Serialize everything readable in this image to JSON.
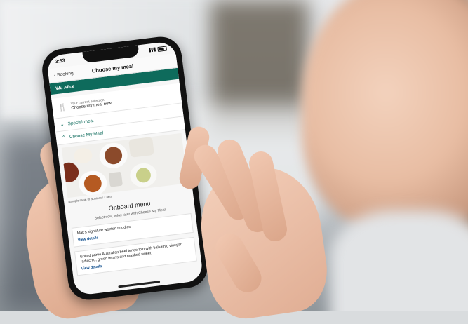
{
  "status_bar": {
    "time": "3:33"
  },
  "nav": {
    "back_label": "Booking",
    "title": "Choose my meal"
  },
  "passenger": {
    "name": "Wu Alice"
  },
  "selection": {
    "label": "Your current selection",
    "value": "Choose my meal now"
  },
  "accordions": [
    {
      "label": "Special meal",
      "expanded": false
    },
    {
      "label": "Choose My Meal",
      "expanded": true
    }
  ],
  "gallery": {
    "caption": "Sample meal in Business Class"
  },
  "menu": {
    "title": "Onboard menu",
    "subtitle": "Select now, relax later with Choose My Meal.",
    "items": [
      {
        "name": "Mak's signature wonton noodles",
        "link": "View details"
      },
      {
        "name": "Grilled prime Australian beef tenderloin with balsamic vinegar radicchio, green beans and mashed sweet",
        "link": "View details"
      }
    ]
  },
  "colors": {
    "brand_green": "#0e6b5c",
    "link_blue": "#0e4d8c"
  },
  "icons": {
    "back": "chevron-left-icon",
    "cutlery": "cutlery-icon",
    "accordion": "chevron-icon"
  }
}
